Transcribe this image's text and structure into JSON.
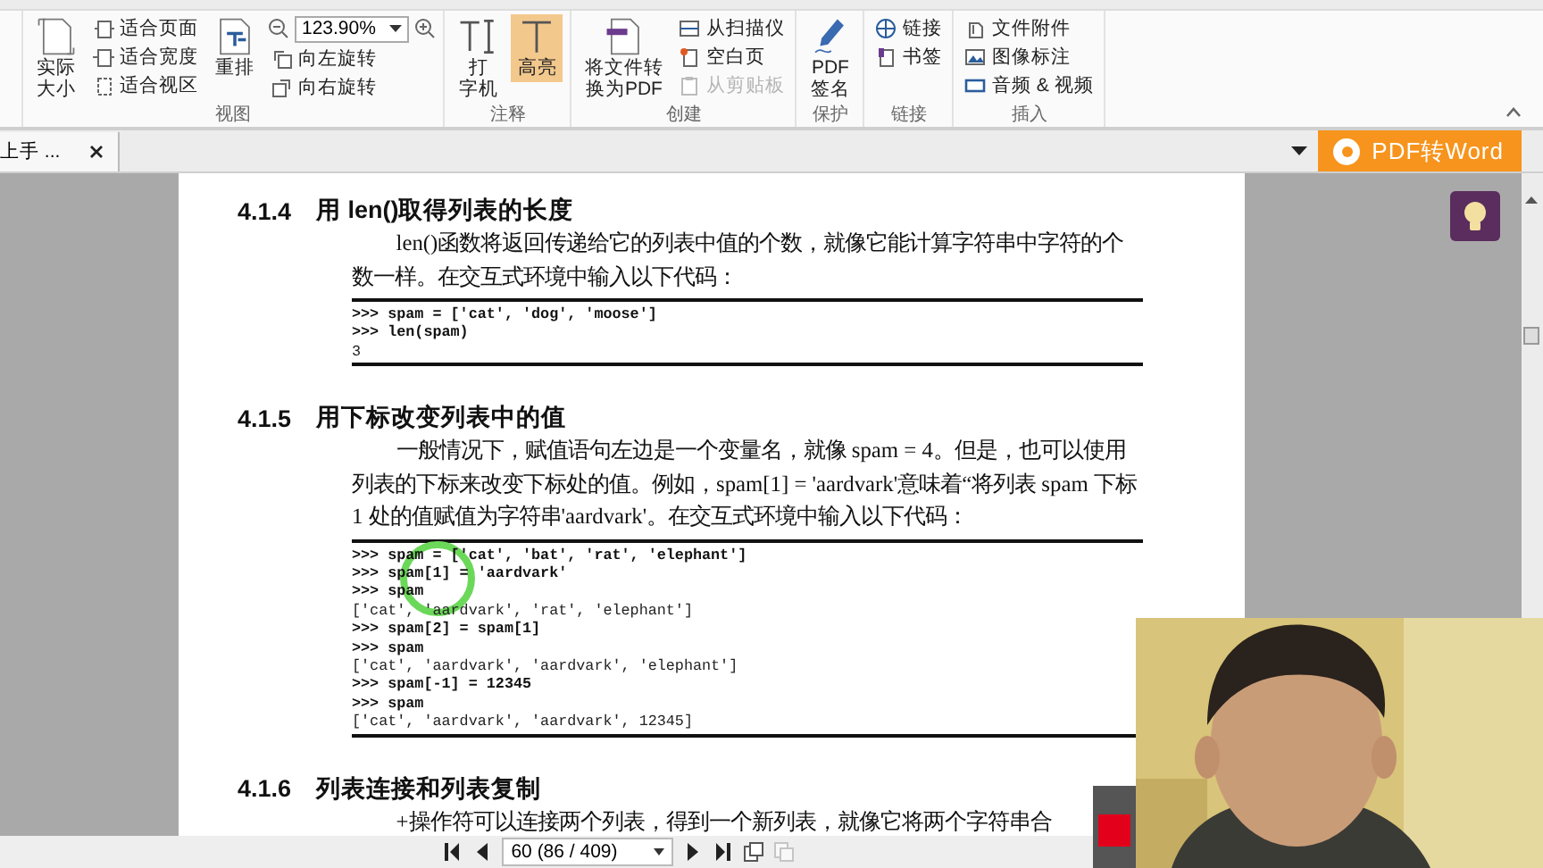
{
  "ribbon": {
    "groups": [
      {
        "label": "视图",
        "items": [
          {
            "kind": "large",
            "lines": [
              "实际",
              "大小"
            ],
            "on": false,
            "disabled": false
          },
          {
            "kind": "small",
            "label": "适合页面",
            "on": false,
            "disabled": false
          },
          {
            "kind": "small",
            "label": "适合宽度",
            "on": false,
            "disabled": false
          },
          {
            "kind": "small",
            "label": "适合视区",
            "on": false,
            "disabled": false
          },
          {
            "kind": "large",
            "lines": [
              "重排"
            ],
            "on": false,
            "disabled": false
          },
          {
            "kind": "zoom",
            "value": "123.90%",
            "on": false,
            "disabled": false
          },
          {
            "kind": "small",
            "label": "向左旋转",
            "on": false,
            "disabled": false
          },
          {
            "kind": "small",
            "label": "向右旋转",
            "on": false,
            "disabled": false
          }
        ]
      },
      {
        "label": "注释",
        "items": [
          {
            "kind": "large",
            "lines": [
              "打",
              "字机"
            ],
            "on": false,
            "disabled": false
          },
          {
            "kind": "large",
            "lines": [
              "高亮"
            ],
            "on": true,
            "disabled": false
          }
        ]
      },
      {
        "label": "创建",
        "items": [
          {
            "kind": "large",
            "lines": [
              "将文件转",
              "换为PDF"
            ],
            "on": false,
            "disabled": false
          },
          {
            "kind": "small",
            "label": "从扫描仪",
            "on": false,
            "disabled": false
          },
          {
            "kind": "small",
            "label": "空白页",
            "on": false,
            "disabled": false
          },
          {
            "kind": "small",
            "label": "从剪贴板",
            "on": false,
            "disabled": true
          }
        ]
      },
      {
        "label": "保护",
        "items": [
          {
            "kind": "large",
            "lines": [
              "PDF",
              "签名"
            ],
            "on": false,
            "disabled": false
          }
        ]
      },
      {
        "label": "链接",
        "items": [
          {
            "kind": "small",
            "label": "链接",
            "on": false,
            "disabled": false
          },
          {
            "kind": "small",
            "label": "书签",
            "on": false,
            "disabled": false
          }
        ]
      },
      {
        "label": "插入",
        "items": [
          {
            "kind": "small",
            "label": "文件附件",
            "on": false,
            "disabled": false
          },
          {
            "kind": "small",
            "label": "图像标注",
            "on": false,
            "disabled": false
          },
          {
            "kind": "small",
            "label": "音频 & 视频",
            "on": false,
            "disabled": false
          }
        ]
      }
    ]
  },
  "tabs": [
    {
      "label": "上手 ...",
      "selected": true
    }
  ],
  "convert_button": {
    "label": "PDF转Word"
  },
  "document": {
    "blocks": [
      {
        "kind": "heading",
        "number": "4.1.4",
        "title": "用 len()取得列表的长度"
      },
      {
        "kind": "paragraph",
        "text": "len()函数将返回传递给它的列表中值的个数，就像它能计算字符串中字符的个数一样。在交互式环境中输入以下代码："
      },
      {
        "kind": "code",
        "lines": [
          {
            "text": ">>> spam = ['cat', 'dog', 'moose']",
            "bold": true
          },
          {
            "text": ">>> len(spam)",
            "bold": true
          },
          {
            "text": "3",
            "bold": false
          }
        ]
      },
      {
        "kind": "heading",
        "number": "4.1.5",
        "title": "用下标改变列表中的值"
      },
      {
        "kind": "paragraph",
        "text": "一般情况下，赋值语句左边是一个变量名，就像 spam = 4。但是，也可以使用列表的下标来改变下标处的值。例如，spam[1] = 'aardvark'意味着“将列表 spam 下标 1 处的值赋值为字符串'aardvark'。在交互式环境中输入以下代码："
      },
      {
        "kind": "code",
        "lines": [
          {
            "text": ">>> spam = ['cat', 'bat', 'rat', 'elephant']",
            "bold": true
          },
          {
            "text": ">>> spam[1] = 'aardvark'",
            "bold": true
          },
          {
            "text": ">>> spam",
            "bold": true
          },
          {
            "text": "['cat', 'aardvark', 'rat', 'elephant']",
            "bold": false
          },
          {
            "text": ">>> spam[2] = spam[1]",
            "bold": true
          },
          {
            "text": ">>> spam",
            "bold": true
          },
          {
            "text": "['cat', 'aardvark', 'aardvark', 'elephant']",
            "bold": false
          },
          {
            "text": ">>> spam[-1] = 12345",
            "bold": true
          },
          {
            "text": ">>> spam",
            "bold": true
          },
          {
            "text": "['cat', 'aardvark', 'aardvark', 12345]",
            "bold": false
          }
        ]
      },
      {
        "kind": "heading",
        "number": "4.1.6",
        "title": "列表连接和列表复制"
      },
      {
        "kind": "paragraph",
        "text": "+操作符可以连接两个列表，得到一个新列表，就像它将两个字符串合"
      }
    ]
  },
  "navigation": {
    "page_field": "60 (86 / 409)"
  }
}
